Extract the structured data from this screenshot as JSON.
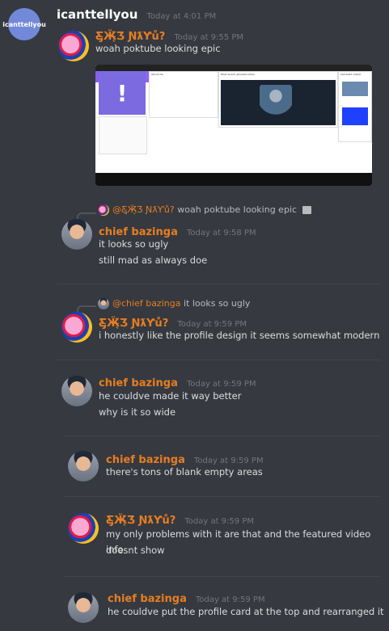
{
  "header": {
    "avatar_text": "icanttellyou",
    "username": "icanttellyou",
    "timestamp": "Today at 4:01 PM"
  },
  "messages": [
    {
      "author": "Ƹ̵̡Ӝ̵̨̄Ʒ ƝƛƳů?",
      "time": "Today at 9:55 PM",
      "lines": [
        "woah poktube looking epic"
      ]
    },
    {
      "reply_author": "@Ƹ̵̡Ӝ̵̨̄Ʒ ƝƛƳů?",
      "reply_text": "woah poktube looking epic",
      "author": "chief bazinga",
      "time": "Today at 9:58 PM",
      "lines": [
        "it looks so ugly",
        "still mad as always doe"
      ]
    },
    {
      "reply_author": "@chief bazinga",
      "reply_text": "it looks so ugly",
      "author": "Ƹ̵̡Ӝ̵̨̄Ʒ ƝƛƳů?",
      "time": "Today at 9:59 PM",
      "lines": [
        "i honestly like the profile design it seems somewhat modern"
      ]
    },
    {
      "author": "chief bazinga",
      "time": "Today at 9:59 PM",
      "lines": [
        "he couldve made it way better",
        "why is it so wide"
      ]
    },
    {
      "author": "chief bazinga",
      "time": "Today at 9:59 PM",
      "lines": [
        "there's tons of blank empty areas"
      ]
    },
    {
      "author": "Ƹ̵̡Ӝ̵̨̄Ʒ ƝƛƳů?",
      "time": "Today at 9:59 PM",
      "lines": [
        "my only problems with it are that and the featured video info",
        "doesnt show"
      ]
    },
    {
      "author": "chief bazinga",
      "time": "Today at 9:59 PM",
      "lines": [
        "he couldve put the profile card at the top and rearranged it"
      ]
    }
  ],
  "embed": {
    "about_me_label": "About me",
    "featured_label": "Most recent uploaded video",
    "uploaded_label": "Uploaded videos"
  },
  "colors": {
    "background": "#36393f",
    "username_orange": "#e67e22",
    "timestamp_gray": "#72767d",
    "text": "#dcddde"
  }
}
